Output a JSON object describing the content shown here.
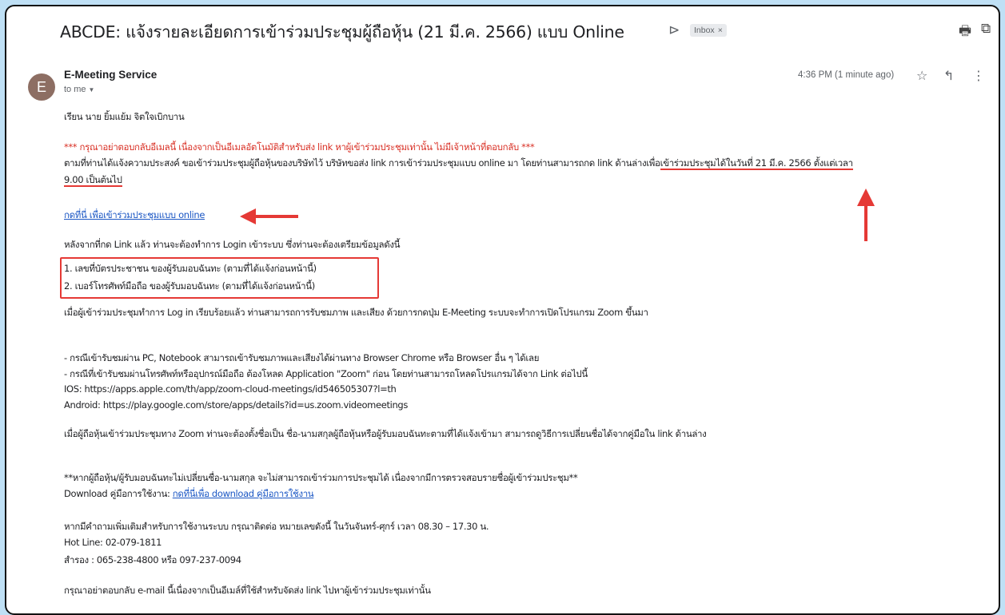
{
  "email": {
    "subject": "ABCDE: แจ้งรายละเอียดการเข้าร่วมประชุมผู้ถือหุ้น (21 มี.ค. 2566) แบบ Online",
    "label": "Inbox",
    "label_close": "×",
    "sender_name": "E-Meeting Service",
    "sender_initial": "E",
    "recipient": "to me",
    "time": "4:36 PM (1 minute ago)"
  },
  "icons": {
    "important": "⊳",
    "print": "🖶",
    "open_new": "⧉",
    "star": "☆",
    "reply": "↰",
    "more": "⋮",
    "dropdown": "▼"
  },
  "body": {
    "greeting": "เรียน นาย ยิ้มแย้ม จิตใจเบิกบาน",
    "warning": "*** กรุณาอย่าตอบกลับอีเมลนี้ เนื่องจากเป็นอีเมลอัตโนมัติสำหรับส่ง link หาผู้เข้าร่วมประชุมเท่านั้น ไม่มีเจ้าหน้าที่ตอบกลับ ***",
    "intro_part1": "ตามที่ท่านได้แจ้งความประสงค์ ขอเข้าร่วมประชุมผู้ถือหุ้นของบริษัทไว้ บริษัทขอส่ง link การเข้าร่วมประชุมแบบ online มา โดยท่านสามารถกด link ด้านล่างเพื่อ",
    "intro_highlight": "เข้าร่วมประชุมได้ในวันที่ 21 มี.ค. 2566 ตั้งแต่เวลา",
    "intro_line2": "9.00 เป็นต้นไป",
    "meeting_link": "กดที่นี่ เพื่อเข้าร่วมประชุมแบบ online",
    "after_click": "หลังจากที่กด Link แล้ว ท่านจะต้องทำการ Login เข้าระบบ ซึ่งท่านจะต้องเตรียมข้อมูลดังนี้",
    "requirements": [
      "1. เลขที่บัตรประชาชน ของผู้รับมอบฉันทะ (ตามที่ได้แจ้งก่อนหน้านี้)",
      "2. เบอร์โทรศัพท์มือถือ ของผู้รับมอบฉันทะ (ตามที่ได้แจ้งก่อนหน้านี้)"
    ],
    "after_login": "เมื่อผู้เข้าร่วมประชุมทำการ Log in เรียบร้อยแล้ว ท่านสามารถการรับชมภาพ และเสียง ด้วยการกดปุ่ม E-Meeting ระบบจะทำการเปิดโปรแกรม Zoom ขึ้นมา",
    "pc_note": "- กรณีเข้ารับชมผ่าน PC, Notebook สามารถเข้ารับชมภาพและเสียงได้ผ่านทาง Browser Chrome หรือ Browser อื่น ๆ ได้เลย",
    "mobile_note": "- กรณีที่เข้ารับชมผ่านโทรศัพท์หรืออุปกรณ์มือถือ ต้องโหลด Application \"Zoom\" ก่อน โดยท่านสามารถโหลดโปรแกรมได้จาก Link ต่อไปนี้",
    "ios_link": "IOS: https://apps.apple.com/th/app/zoom-cloud-meetings/id546505307?l=th",
    "android_link": "Android: https://play.google.com/store/apps/details?id=us.zoom.videomeetings",
    "zoom_name": "เมื่อผู้ถือหุ้นเข้าร่วมประชุมทาง Zoom ท่านจะต้องตั้งชื่อเป็น ชื่อ-นามสกุลผู้ถือหุ้นหรือผู้รับมอบฉันทะตามที่ได้แจ้งเข้ามา สามารถดูวิธีการเปลี่ยนชื่อได้จากคู่มือใน link ด้านล่าง",
    "name_warning": "**หากผู้ถือหุ้น/ผู้รับมอบฉันทะไม่เปลี่ยนชื่อ-นามสกุล จะไม่สามารถเข้าร่วมการประชุมได้ เนื่องจากมีการตรวจสอบรายชื่อผู้เข้าร่วมประชุม**",
    "download_label": "Download คู่มือการใช้งาน: ",
    "download_link": "กดที่นี่เพื่อ download คู่มือการใช้งาน",
    "contact": "หากมีคำถามเพิ่มเติมสำหรับการใช้งานระบบ กรุณาติดต่อ หมายเลขดังนี้ ในวันจันทร์-ศุกร์ เวลา 08.30 – 17.30 น.",
    "hotline": "Hot Line: 02-079-1811",
    "backup": "สำรอง : 065-238-4800 หรือ 097-237-0094",
    "footer": "กรุณาอย่าตอบกลับ e-mail นี้เนื่องจากเป็นอีเมล์ที่ใช้สำหรับจัดส่ง link ไปหาผู้เข้าร่วมประชุมเท่านั้น"
  },
  "colors": {
    "annotation": "#e53935",
    "link": "#1a56c4",
    "background": "#bfe0f5"
  }
}
